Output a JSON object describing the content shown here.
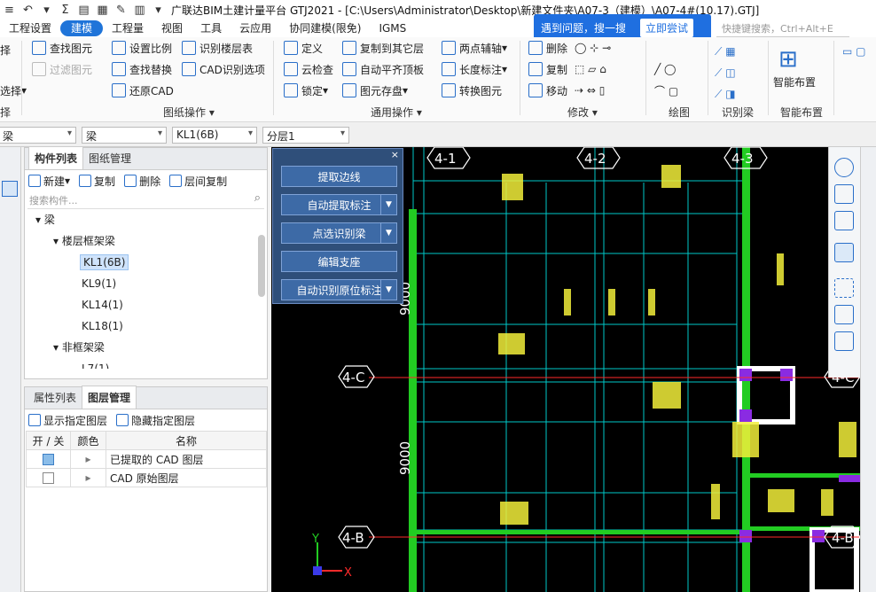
{
  "titlebar": {
    "title": "广联达BIM土建计量平台 GTJ2021 - [C:\\Users\\Administrator\\Desktop\\新建文件夹\\A07-3（建模）\\A07-4#(10.17).GTJ]"
  },
  "menu": [
    "工程设置",
    "建模",
    "工程量",
    "视图",
    "工具",
    "云应用",
    "协同建模(限免)",
    "IGMS"
  ],
  "promo": {
    "text": "遇到问题，搜一搜",
    "button": "立即尝试"
  },
  "quick_search": {
    "placeholder": "快捷键搜索，Ctrl+Alt+E"
  },
  "ribbon": {
    "left_cut": [
      "择",
      "选择",
      "择"
    ],
    "drawing": {
      "items": [
        "查找图元",
        "过滤图元",
        "设置比例",
        "查找替换",
        "还原CAD",
        "识别楼层表",
        "CAD识别选项"
      ],
      "label": "图纸操作"
    },
    "general": {
      "items": [
        "定义",
        "云检查",
        "锁定",
        "复制到其它层",
        "自动平齐顶板",
        "图元存盘",
        "两点辅轴",
        "长度标注",
        "转换图元"
      ],
      "label": "通用操作"
    },
    "modify": {
      "items": [
        "删除",
        "复制",
        "移动"
      ],
      "label": "修改"
    },
    "draw": {
      "label": "绘图"
    },
    "recognize": {
      "label": "识别梁"
    },
    "smart": {
      "item": "智能布置",
      "label": "智能布置"
    }
  },
  "selectors": [
    "梁",
    "梁",
    "KL1(6B)",
    "分层1"
  ],
  "component_panel": {
    "tabs": [
      "构件列表",
      "图纸管理"
    ],
    "tools": [
      "新建",
      "复制",
      "删除",
      "层间复制"
    ],
    "search_placeholder": "搜索构件...",
    "tree": {
      "root": "梁",
      "group1": "楼层框架梁",
      "items": [
        "KL1(6B)",
        "KL9(1)",
        "KL14(1)",
        "KL18(1)"
      ],
      "group2": "非框架梁",
      "partial": "L7(1)"
    }
  },
  "layer_panel": {
    "tabs": [
      "属性列表",
      "图层管理"
    ],
    "tools": [
      "显示指定图层",
      "隐藏指定图层"
    ],
    "headers": [
      "开 / 关",
      "颜色",
      "名称"
    ],
    "rows": [
      {
        "name": "已提取的 CAD 图层",
        "on": true
      },
      {
        "name": "CAD 原始图层",
        "on": false
      }
    ]
  },
  "float_panel": {
    "buttons": [
      "提取边线",
      "自动提取标注",
      "点选识别梁",
      "编辑支座",
      "自动识别原位标注"
    ]
  },
  "cad": {
    "axes_x": [
      "4-1",
      "4-2",
      "4-3"
    ],
    "axes_y": [
      "4-C",
      "4-B"
    ],
    "dims": [
      "9000",
      "9000"
    ],
    "axis_labels": {
      "y": "Y",
      "x": "X"
    },
    "colors": {
      "grid": "#00d4d4",
      "green": "#22cc22",
      "yellow": "#f2ef3a",
      "purple": "#8a2be2",
      "white": "#ffffff",
      "red": "#ff2a2a"
    }
  }
}
